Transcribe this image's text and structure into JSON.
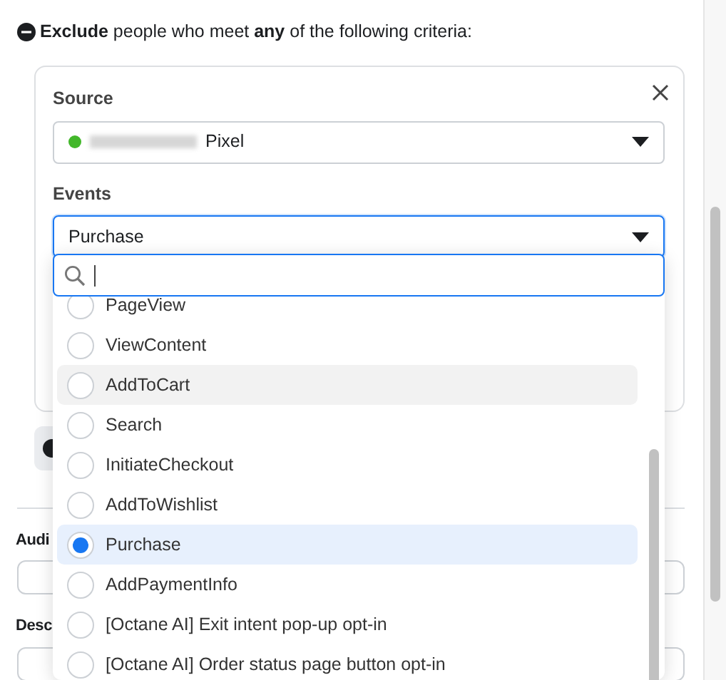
{
  "header": {
    "text": "**Exclude** people who meet **any** of the following criteria:"
  },
  "criteria_card": {
    "source": {
      "label": "Source",
      "value": "Pixel"
    },
    "events": {
      "label": "Events",
      "value": "Purchase",
      "focused": true
    }
  },
  "events_dropdown": {
    "search": {
      "focused": true
    },
    "options": [
      {
        "label": "PageView",
        "selected": false,
        "hovered": false
      },
      {
        "label": "ViewContent",
        "selected": false,
        "hovered": false
      },
      {
        "label": "AddToCart",
        "selected": false,
        "hovered": true
      },
      {
        "label": "Search",
        "selected": false,
        "hovered": false
      },
      {
        "label": "InitiateCheckout",
        "selected": false,
        "hovered": false
      },
      {
        "label": "AddToWishlist",
        "selected": false,
        "hovered": false
      },
      {
        "label": "Purchase",
        "selected": true,
        "hovered": false
      },
      {
        "label": "AddPaymentInfo",
        "selected": false,
        "hovered": false
      },
      {
        "label": "[Octane AI] Exit intent pop-up opt-in",
        "selected": false,
        "hovered": false
      },
      {
        "label": "[Octane AI] Order status page button opt-in",
        "selected": false,
        "hovered": false
      }
    ]
  },
  "fields": [
    {
      "label": "Audi"
    },
    {
      "label": "Desc"
    }
  ]
}
